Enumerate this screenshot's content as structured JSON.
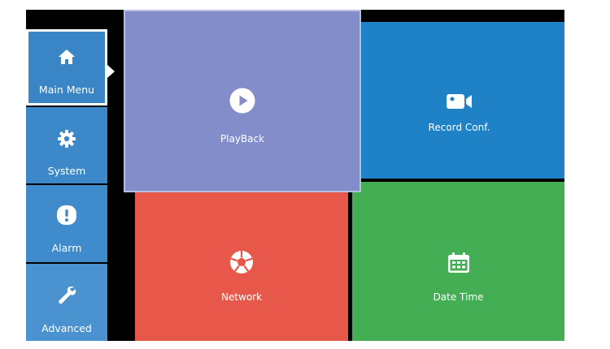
{
  "sidebar": {
    "items": [
      {
        "label": "Main Menu",
        "icon": "home-icon"
      },
      {
        "label": "System",
        "icon": "gear-icon"
      },
      {
        "label": "Alarm",
        "icon": "alert-icon"
      },
      {
        "label": "Advanced",
        "icon": "wrench-icon"
      }
    ]
  },
  "tiles": {
    "playback": {
      "label": "PlayBack",
      "icon": "play-icon",
      "color": "#838dc9"
    },
    "record": {
      "label": "Record Conf.",
      "icon": "video-camera-icon",
      "color": "#1f82c7"
    },
    "network": {
      "label": "Network",
      "icon": "network-icon",
      "color": "#e8584a"
    },
    "datetime": {
      "label": "Date Time",
      "icon": "calendar-icon",
      "color": "#43ae53"
    }
  },
  "colors": {
    "sidebar_active": "#3a85c6",
    "sidebar_item": "#3d88c9",
    "background": "#000000"
  }
}
